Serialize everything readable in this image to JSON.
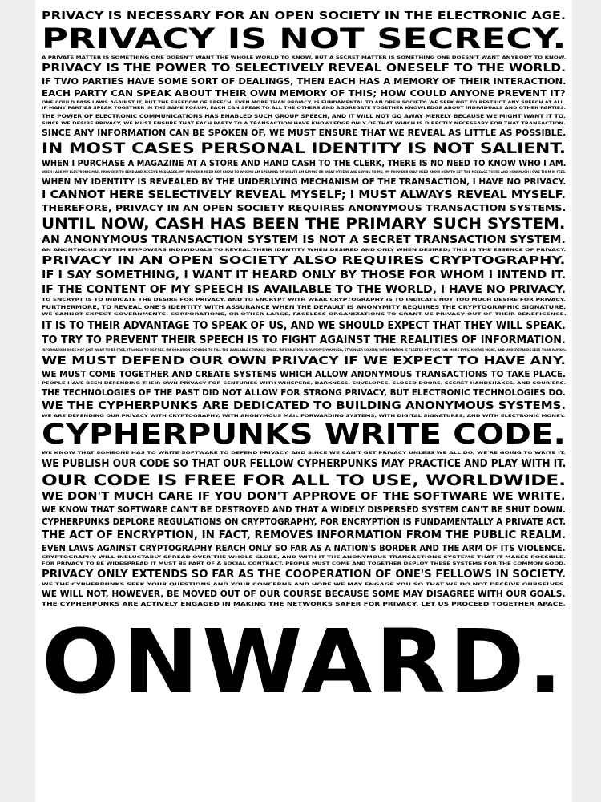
{
  "poster": {
    "lines": [
      {
        "text": "Privacy is necessary for an open society in the electronic age.",
        "size": "l"
      },
      {
        "text": "Privacy is not secrecy.",
        "size": "xxl"
      },
      {
        "text": "A private matter is something one doesn't want the whole world to know, but a secret matter is something one doesn't want anybody to know.",
        "size": "xs"
      },
      {
        "text": "Privacy is the power to selectively reveal oneself to the world.",
        "size": "l"
      },
      {
        "text": "If two parties have some sort of dealings, then each has a memory of their interaction.",
        "size": "m"
      },
      {
        "text": "Each party can speak about their own memory of this; how could anyone prevent it?",
        "size": "m"
      },
      {
        "text": "One could pass laws against it, but the freedom of speech, even more than privacy, is fundamental to an open society; we seek not to restrict any speech at all.",
        "size": "xs"
      },
      {
        "text": "If many parties speak together in the same forum, each can speak to all the others and aggregate together knowledge about individuals and other parties.",
        "size": "xs"
      },
      {
        "text": "The power of electronic communications has enabled such group speech, and it will not go away merely because we might want it to.",
        "size": "s"
      },
      {
        "text": "Since we desire privacy, we must ensure that each party to a transaction have knowledge only of that which is directly necessary for that transaction.",
        "size": "xs"
      },
      {
        "text": "Since any information can be spoken of, we must ensure that we reveal as little as possible.",
        "size": "m"
      },
      {
        "text": "In most cases personal identity is not salient.",
        "size": "xl"
      },
      {
        "text": "When I purchase a magazine at a store and hand cash to the clerk, there is no need to know who I am.",
        "size": "m"
      },
      {
        "text": "When I ask my electronic mail provider to send and receive messages, my provider need not know to whom I am speaking or what I am saying or what others are saying to me; my provider only need know how to get the message there and how much I owe them in fees.",
        "size": "xs"
      },
      {
        "text": "When my identity is revealed by the underlying mechanism of the transaction, I have no privacy.",
        "size": "m"
      },
      {
        "text": "I cannot here selectively reveal myself; I must always reveal myself.",
        "size": "l"
      },
      {
        "text": "Therefore, privacy in an open society requires anonymous transaction systems.",
        "size": "m"
      },
      {
        "text": "Until now, cash has been the primary such system.",
        "size": "xl"
      },
      {
        "text": "An anonymous transaction system is not a secret transaction system.",
        "size": "l"
      },
      {
        "text": "An anonymous system empowers individuals to reveal their identity when desired and only when desired; this is the essence of privacy.",
        "size": "xs"
      },
      {
        "text": "Privacy in an open society also requires cryptography.",
        "size": "l"
      },
      {
        "text": "If I say something, I want it heard only by those for whom I intend it.",
        "size": "l"
      },
      {
        "text": "If the content of my speech is available to the world, I have no privacy.",
        "size": "l"
      },
      {
        "text": "To encrypt is to indicate the desire for privacy, and to encrypt with weak cryptography is to indicate not too much desire for privacy.",
        "size": "xs"
      },
      {
        "text": "Furthermore, to reveal one's identity with assurance when the default is anonymity requires the cryptographic signature.",
        "size": "s"
      },
      {
        "text": "We cannot expect governments, corporations, or other large, faceless organizations to grant us privacy out of their beneficence.",
        "size": "xs"
      },
      {
        "text": "It is to their advantage to speak of us, and we should expect that they will speak.",
        "size": "l"
      },
      {
        "text": "To try to prevent their speech is to fight against the realities of information.",
        "size": "l"
      },
      {
        "text": "Information does not just want to be free, it longs to be free. Information expands to fill the available storage space. Information is Rumor's younger, stronger cousin; Information is fleeter of foot, has more eyes, knows more, and understands less than Rumor.",
        "size": "xs"
      },
      {
        "text": "We must defend our own privacy if we expect to have any.",
        "size": "l"
      },
      {
        "text": "We must come together and create systems which allow anonymous transactions to take place.",
        "size": "m"
      },
      {
        "text": "People have been defending their own privacy for centuries with whispers, darkness, envelopes, closed doors, secret handshakes, and couriers.",
        "size": "xs"
      },
      {
        "text": "The technologies of the past did not allow for strong privacy, but electronic technologies do.",
        "size": "m"
      },
      {
        "text": "We the Cypherpunks are dedicated to building anonymous systems.",
        "size": "l"
      },
      {
        "text": "We are defending our privacy with cryptography, with anonymous mail forwarding systems, with digital signatures, and with electronic money.",
        "size": "xs"
      },
      {
        "text": "Cypherpunks write code.",
        "size": "xxl"
      },
      {
        "text": "We know that someone has to write software to defend privacy, and since we can't get privacy unless we all do, we're going to write it.",
        "size": "xs"
      },
      {
        "text": "We publish our code so that our fellow Cypherpunks may practice and play with it.",
        "size": "l"
      },
      {
        "text": "Our code is free for all to use, worldwide.",
        "size": "xl"
      },
      {
        "text": "We don't much care if you don't approve of the software we write.",
        "size": "l"
      },
      {
        "text": "We know that software can't be destroyed and that a widely dispersed system can't be shut down.",
        "size": "m"
      },
      {
        "text": "Cypherpunks deplore regulations on cryptography, for encryption is fundamentally a private act.",
        "size": "m"
      },
      {
        "text": "The act of encryption, in fact, removes information from the public realm.",
        "size": "l"
      },
      {
        "text": "Even laws against cryptography reach only so far as a nation's border and the arm of its violence.",
        "size": "m"
      },
      {
        "text": "Cryptography will ineluctably spread over the whole globe, and with it the anonymous transactions systems that it makes possible.",
        "size": "xs"
      },
      {
        "text": "For privacy to be widespread it must be part of a social contract. People must come and together deploy these systems for the common good.",
        "size": "xs"
      },
      {
        "text": "Privacy only extends so far as the cooperation of one's fellows in society.",
        "size": "l"
      },
      {
        "text": "We the Cypherpunks seek your questions and your concerns and hope we may engage you so that we do not deceive ourselves.",
        "size": "xs"
      },
      {
        "text": "We will not, however, be moved out of our course because some may disagree with our goals.",
        "size": "m"
      },
      {
        "text": "The Cypherpunks are actively engaged in making the networks safer for privacy. Let us proceed together apace.",
        "size": "s"
      }
    ],
    "closing": "Onward."
  }
}
